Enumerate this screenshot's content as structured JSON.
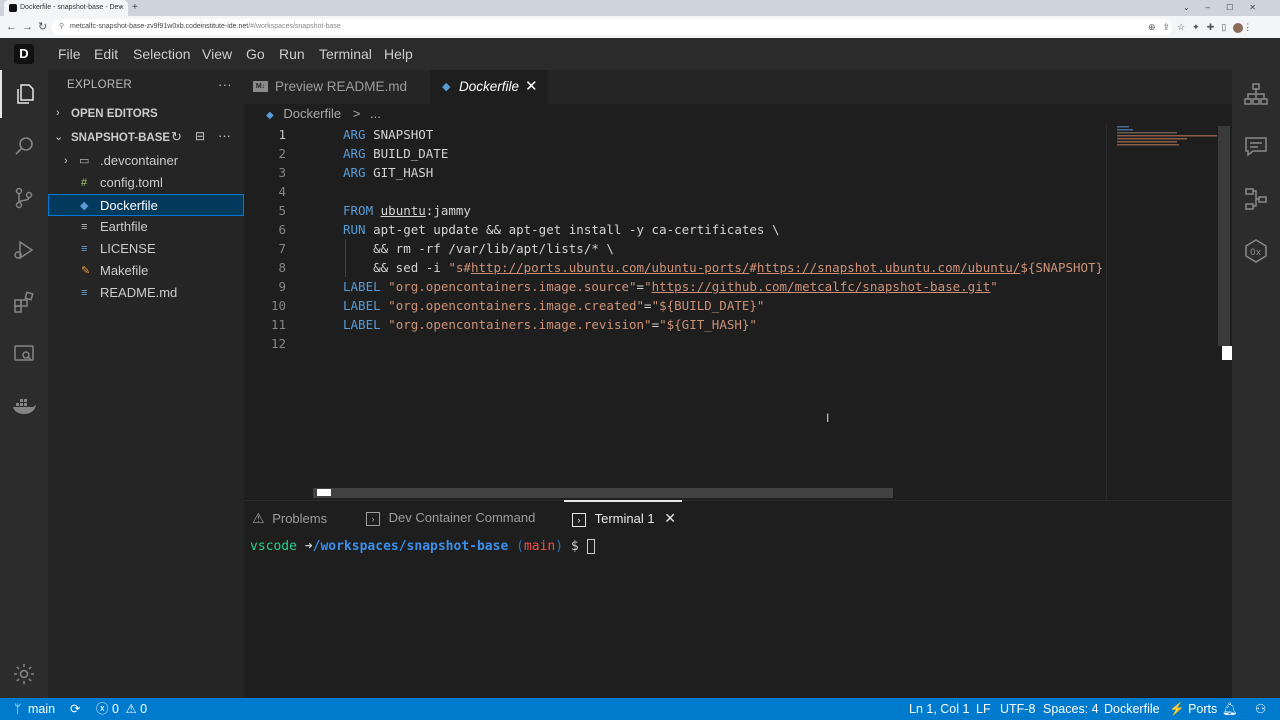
{
  "browser": {
    "tab_title": "Dockerfile - snapshot-base - Dev",
    "new_tab": "+",
    "url_host": "metcalfc-snapshot-base-zv9f91w0xb.codeinstitute-ide.net",
    "url_path": "/#/workspaces/snapshot-base"
  },
  "app": {
    "logo_letter": "D",
    "menu": [
      "File",
      "Edit",
      "Selection",
      "View",
      "Go",
      "Run",
      "Terminal",
      "Help"
    ]
  },
  "sidebar": {
    "title": "EXPLORER",
    "more": "···",
    "open_editors": "OPEN EDITORS",
    "folder": "SNAPSHOT-BASE",
    "items": [
      {
        "label": ".devcontainer",
        "icon": "folder-icon"
      },
      {
        "label": "config.toml",
        "icon": "toml-file-icon"
      },
      {
        "label": "Dockerfile",
        "icon": "docker-file-icon"
      },
      {
        "label": "Earthfile",
        "icon": "text-file-icon"
      },
      {
        "label": "LICENSE",
        "icon": "license-file-icon"
      },
      {
        "label": "Makefile",
        "icon": "makefile-icon"
      },
      {
        "label": "README.md",
        "icon": "markdown-file-icon"
      }
    ]
  },
  "editor": {
    "tabs": [
      {
        "label": "Preview README.md",
        "active": false
      },
      {
        "label": "Dockerfile",
        "active": true
      }
    ],
    "breadcrumb": {
      "file": "Dockerfile",
      "sep": ">",
      "more": "..."
    },
    "lines": [
      {
        "n": "1",
        "tokens": [
          {
            "t": "ARG",
            "c": "kw"
          },
          {
            "t": " SNAPSHOT",
            "c": ""
          }
        ]
      },
      {
        "n": "2",
        "tokens": [
          {
            "t": "ARG",
            "c": "kw"
          },
          {
            "t": " BUILD_DATE",
            "c": ""
          }
        ]
      },
      {
        "n": "3",
        "tokens": [
          {
            "t": "ARG",
            "c": "kw"
          },
          {
            "t": " GIT_HASH",
            "c": ""
          }
        ]
      },
      {
        "n": "4",
        "tokens": []
      },
      {
        "n": "5",
        "tokens": [
          {
            "t": "FROM",
            "c": "kw"
          },
          {
            "t": " ",
            "c": ""
          },
          {
            "t": "ubuntu",
            "c": "link"
          },
          {
            "t": ":jammy",
            "c": ""
          }
        ]
      },
      {
        "n": "6",
        "tokens": [
          {
            "t": "RUN",
            "c": "kw"
          },
          {
            "t": " apt-get update && apt-get install -y ca-certificates \\",
            "c": ""
          }
        ]
      },
      {
        "n": "7",
        "tokens": [
          {
            "t": "    && rm -rf /var/lib/apt/lists/* \\",
            "c": ""
          }
        ]
      },
      {
        "n": "8",
        "tokens": [
          {
            "t": "    && sed -i ",
            "c": ""
          },
          {
            "t": "\"s#",
            "c": "str"
          },
          {
            "t": "http://ports.ubuntu.com/ubuntu-ports/",
            "c": "str link"
          },
          {
            "t": "#",
            "c": "str"
          },
          {
            "t": "https://snapshot.ubuntu.com/ubuntu/",
            "c": "str link"
          },
          {
            "t": "${SNAPSHOT}",
            "c": "str"
          }
        ]
      },
      {
        "n": "9",
        "tokens": [
          {
            "t": "LABEL",
            "c": "kw"
          },
          {
            "t": " ",
            "c": ""
          },
          {
            "t": "\"org.opencontainers.image.source\"",
            "c": "str"
          },
          {
            "t": "=",
            "c": ""
          },
          {
            "t": "\"",
            "c": "str"
          },
          {
            "t": "https://github.com/metcalfc/snapshot-base.git",
            "c": "str link"
          },
          {
            "t": "\"",
            "c": "str"
          }
        ]
      },
      {
        "n": "10",
        "tokens": [
          {
            "t": "LABEL",
            "c": "kw"
          },
          {
            "t": " ",
            "c": ""
          },
          {
            "t": "\"org.opencontainers.image.created\"",
            "c": "str"
          },
          {
            "t": "=",
            "c": ""
          },
          {
            "t": "\"${BUILD_DATE}\"",
            "c": "str"
          }
        ]
      },
      {
        "n": "11",
        "tokens": [
          {
            "t": "LABEL",
            "c": "kw"
          },
          {
            "t": " ",
            "c": ""
          },
          {
            "t": "\"org.opencontainers.image.revision\"",
            "c": "str"
          },
          {
            "t": "=",
            "c": ""
          },
          {
            "t": "\"${GIT_HASH}\"",
            "c": "str"
          }
        ]
      },
      {
        "n": "12",
        "tokens": []
      }
    ]
  },
  "panel": {
    "tabs": [
      "Problems",
      "Dev Container Command",
      "Terminal 1"
    ],
    "prompt": {
      "user": "vscode",
      "arrow": "➜",
      "path": "/workspaces/snapshot-base",
      "open": "(",
      "branch": "main",
      "close": ")",
      "dollar": "$"
    }
  },
  "status": {
    "branch": "main",
    "errors": "0",
    "warnings": "0",
    "position": "Ln 1, Col 1",
    "eol": "LF",
    "encoding": "UTF-8",
    "spaces": "Spaces: 4",
    "language": "Dockerfile",
    "ports": "Ports"
  },
  "colors": {
    "accent": "#007acc",
    "selection": "#04395e",
    "keyword": "#569cd6",
    "string": "#ce9178"
  }
}
